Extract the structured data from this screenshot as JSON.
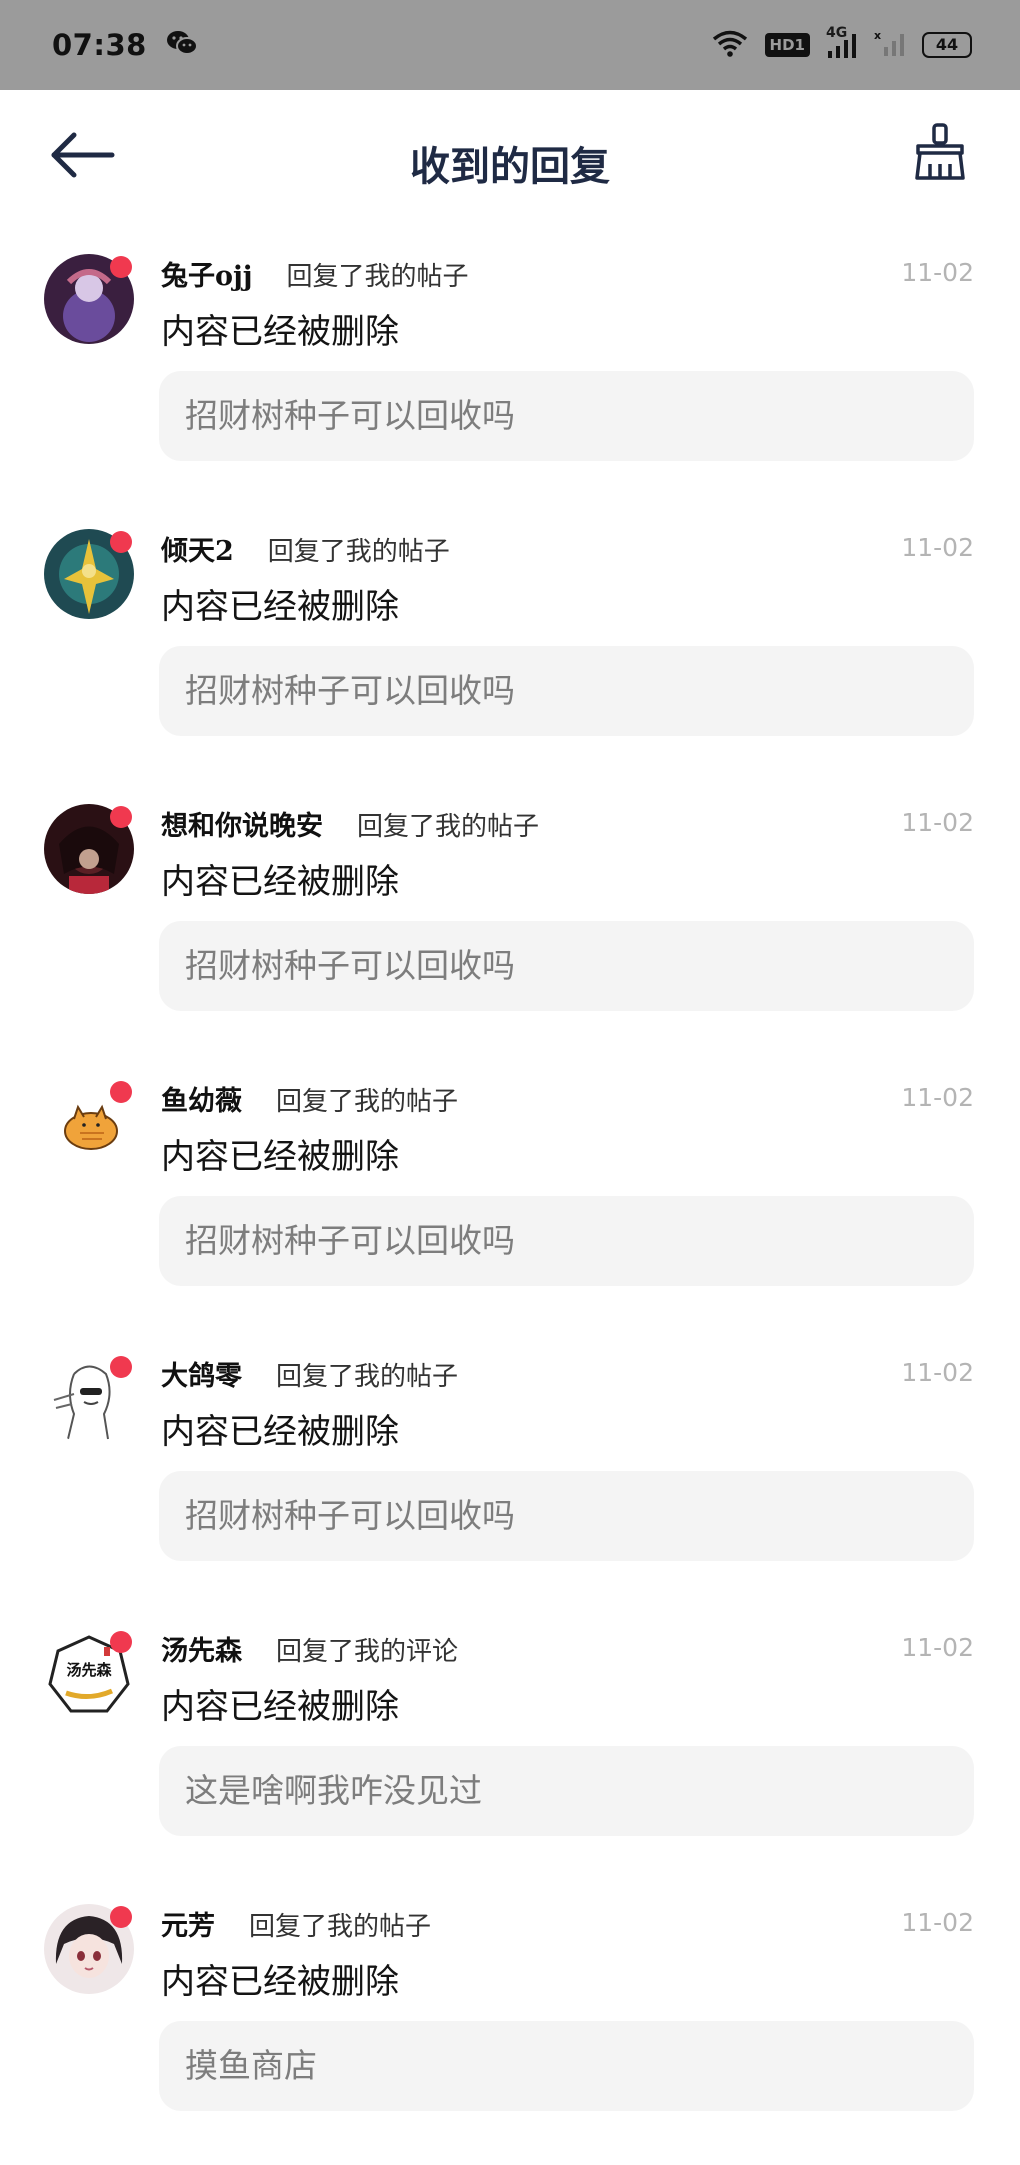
{
  "status_bar": {
    "time": "07:38",
    "hd_label": "HD1",
    "network_label": "4G",
    "battery": "44",
    "icons": [
      "wechat-icon",
      "wifi-icon",
      "signal-icon",
      "signal-empty-icon",
      "battery-icon"
    ]
  },
  "header": {
    "title": "收到的回复",
    "back_icon": "back-arrow-icon",
    "clear_icon": "broom-icon"
  },
  "replies": [
    {
      "username": "兔子ojj",
      "action": "回复了我的帖子",
      "date": "11-02",
      "content": "内容已经被删除",
      "quote": "招财树种子可以回收吗",
      "unread": true
    },
    {
      "username": "倾天2",
      "action": "回复了我的帖子",
      "date": "11-02",
      "content": "内容已经被删除",
      "quote": "招财树种子可以回收吗",
      "unread": true
    },
    {
      "username": "想和你说晚安",
      "action": "回复了我的帖子",
      "date": "11-02",
      "content": "内容已经被删除",
      "quote": "招财树种子可以回收吗",
      "unread": true
    },
    {
      "username": "鱼幼薇",
      "action": "回复了我的帖子",
      "date": "11-02",
      "content": "内容已经被删除",
      "quote": "招财树种子可以回收吗",
      "unread": true
    },
    {
      "username": "大鸽零",
      "action": "回复了我的帖子",
      "date": "11-02",
      "content": "内容已经被删除",
      "quote": "招财树种子可以回收吗",
      "unread": true
    },
    {
      "username": "汤先森",
      "action": "回复了我的评论",
      "date": "11-02",
      "content": "内容已经被删除",
      "quote": "这是啥啊我咋没见过",
      "unread": true,
      "avatar_text": "汤先森"
    },
    {
      "username": "元芳",
      "action": "回复了我的帖子",
      "date": "11-02",
      "content": "内容已经被删除",
      "quote": "摸鱼商店",
      "unread": true
    }
  ],
  "colors": {
    "status_bar_bg": "#9b9b9b",
    "title": "#1f2a44",
    "unread_dot": "#f0394f",
    "date": "#b4b4b4",
    "quote_bg": "#f4f4f4",
    "quote_text": "#7d7d7d"
  }
}
